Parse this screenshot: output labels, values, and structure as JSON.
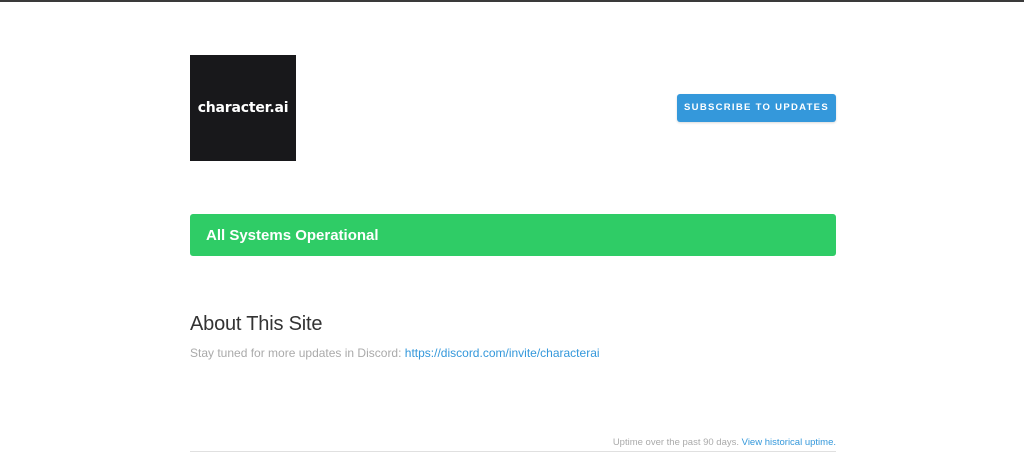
{
  "header": {
    "logo_text": "character.ai",
    "subscribe_label": "SUBSCRIBE TO UPDATES"
  },
  "status": {
    "text": "All Systems Operational",
    "color": "#2fcc66"
  },
  "about": {
    "title": "About This Site",
    "body_prefix": "Stay tuned for more updates in Discord: ",
    "link_text": "https://discord.com/invite/characterai"
  },
  "uptime": {
    "text": "Uptime over the past 90 days. ",
    "link_text": "View historical uptime."
  },
  "colors": {
    "accent": "#3498db",
    "operational": "#2fcc66",
    "logo_bg": "#18181b"
  }
}
